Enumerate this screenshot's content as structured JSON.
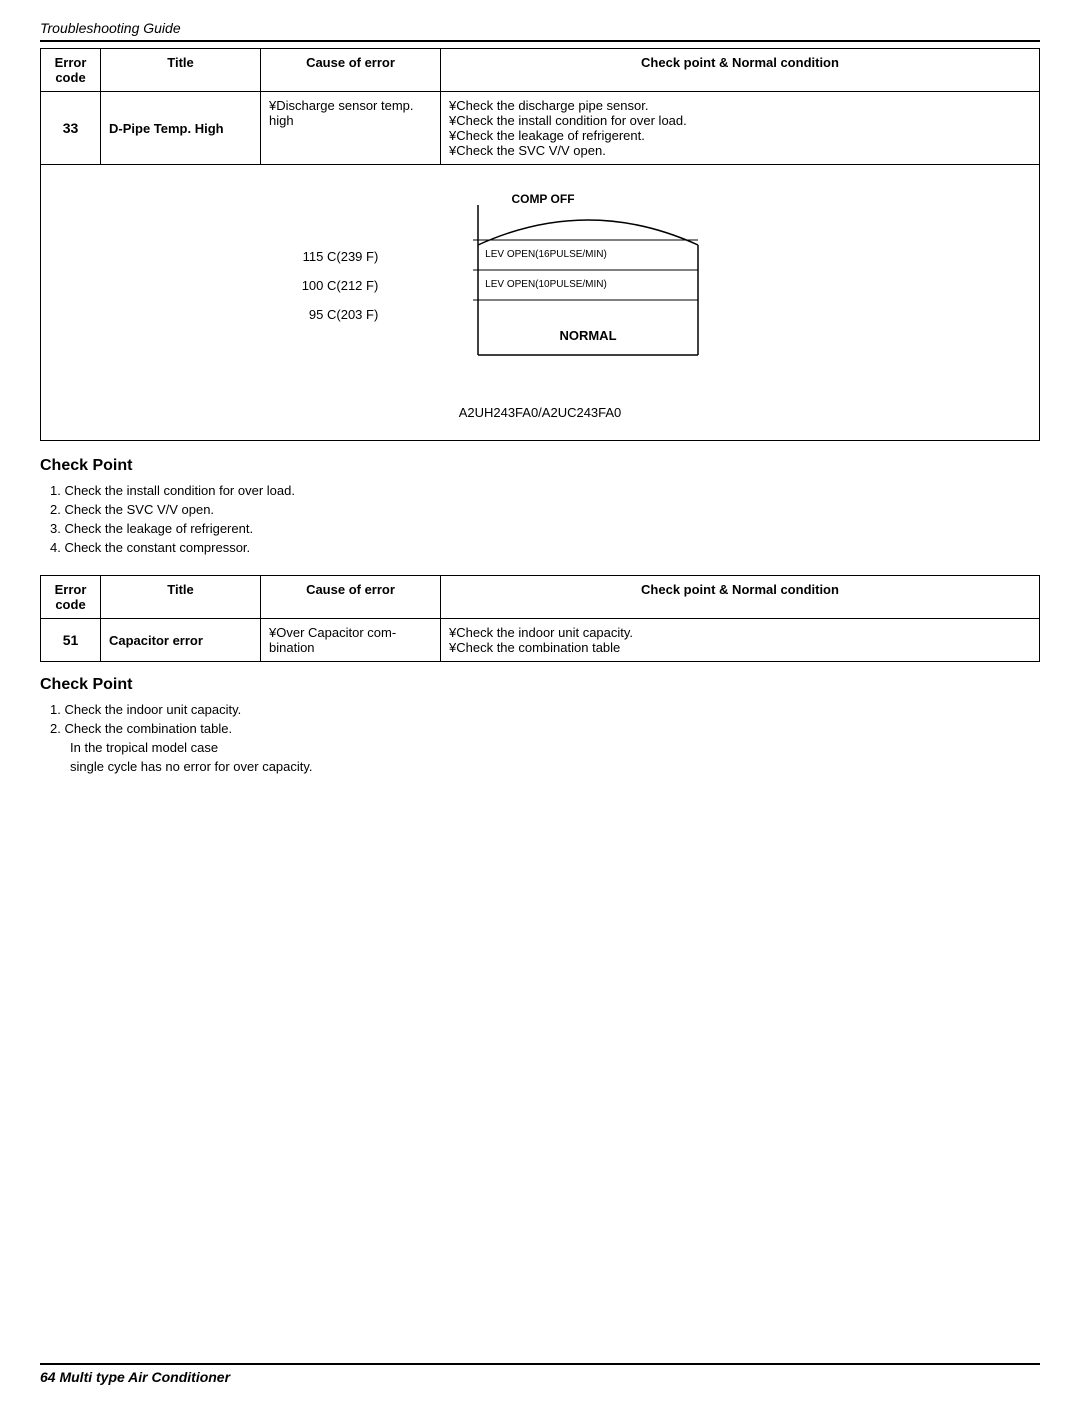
{
  "page": {
    "header": "Troubleshooting Guide",
    "footer": "64   Multi type Air Conditioner"
  },
  "table1": {
    "headers": {
      "error_code": "Error\ncode",
      "title": "Title",
      "cause": "Cause of error",
      "check": "Check point & Normal condition"
    },
    "row": {
      "code": "33",
      "title": "D-Pipe Temp. High",
      "cause": "¥Discharge sensor temp. high",
      "check_items": [
        "¥Check the discharge pipe sensor.",
        "¥Check the install condition for over load.",
        "¥Check the leakage of refrigerent.",
        "¥Check the SVC V/V open."
      ]
    }
  },
  "diagram": {
    "labels": [
      "115 C(239 F)",
      "100 C(212 F)",
      "95 C(203 F)"
    ],
    "annotations": [
      "COMP OFF",
      "LEV OPEN(16PULSE/MIN)",
      "LEV OPEN(10PULSE/MIN)",
      "NORMAL"
    ],
    "model": "A2UH243FA0/A2UC243FA0"
  },
  "check_point_1": {
    "title": "Check Point",
    "items": [
      "1. Check the install condition for over load.",
      "2. Check the SVC V/V open.",
      "3. Check the leakage of refrigerent.",
      "4. Check the constant compressor."
    ]
  },
  "table2": {
    "headers": {
      "error_code": "Error\ncode",
      "title": "Title",
      "cause": "Cause of error",
      "check": "Check point & Normal condition"
    },
    "row": {
      "code": "51",
      "title": "Capacitor error",
      "cause": "¥Over Capacitor combination",
      "check_items": [
        "¥Check the indoor unit capacity.",
        "¥Check the combination table"
      ]
    }
  },
  "check_point_2": {
    "title": "Check Point",
    "items": [
      "1. Check the indoor unit capacity.",
      "2. Check the combination table."
    ],
    "note1": "In the tropical model case",
    "note2": "single cycle has no error for over capacity."
  }
}
